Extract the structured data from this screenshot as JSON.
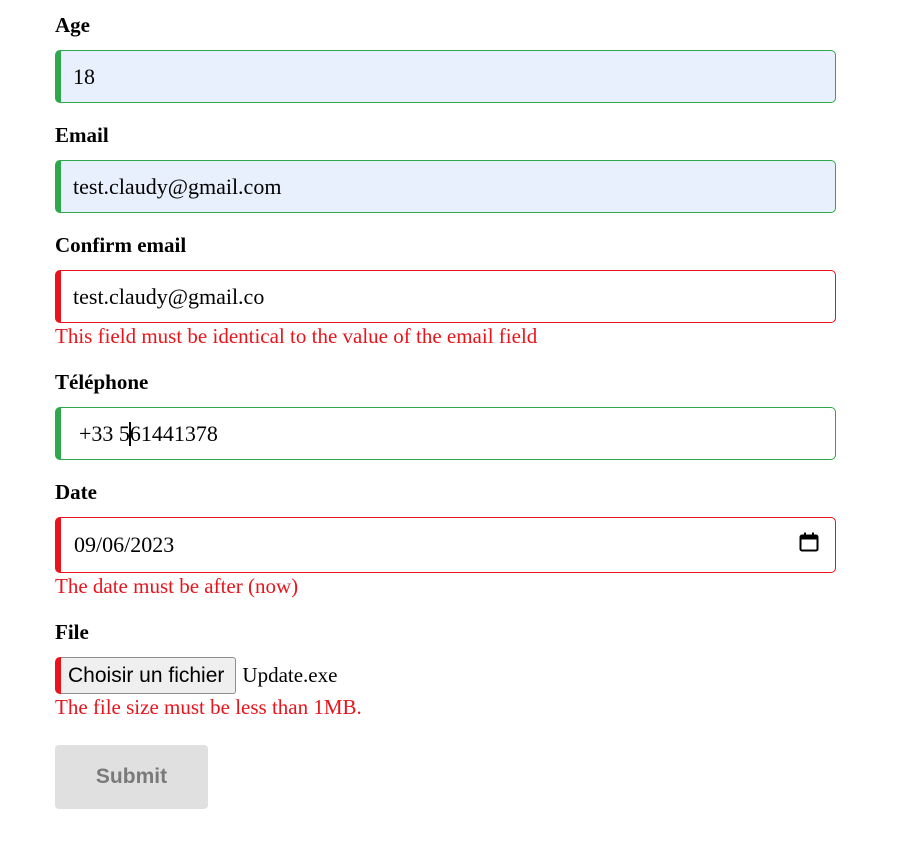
{
  "fields": {
    "age": {
      "label": "Age",
      "value": "18"
    },
    "email": {
      "label": "Email",
      "value": "test.claudy@gmail.com"
    },
    "confirm_email": {
      "label": "Confirm email",
      "value": "test.claudy@gmail.co",
      "error": "This field must be identical to the value of the email field"
    },
    "telephone": {
      "label": "Téléphone",
      "value_before_caret": "+33 5",
      "value_after_caret": "61441378"
    },
    "date": {
      "label": "Date",
      "value": "09/06/2023",
      "icon": "calendar-icon",
      "error": "The date must be after (now)"
    },
    "file": {
      "label": "File",
      "button_label": "Choisir un fichier",
      "file_name": "Update.exe",
      "error": "The file size must be less than 1MB."
    }
  },
  "submit": {
    "label": "Submit"
  },
  "colors": {
    "valid": "#2ea84a",
    "invalid": "#e8141c",
    "autofill_background": "#e8f0fe",
    "submit_disabled_background": "#e0e0e0",
    "submit_disabled_text": "#7a7a7a"
  }
}
